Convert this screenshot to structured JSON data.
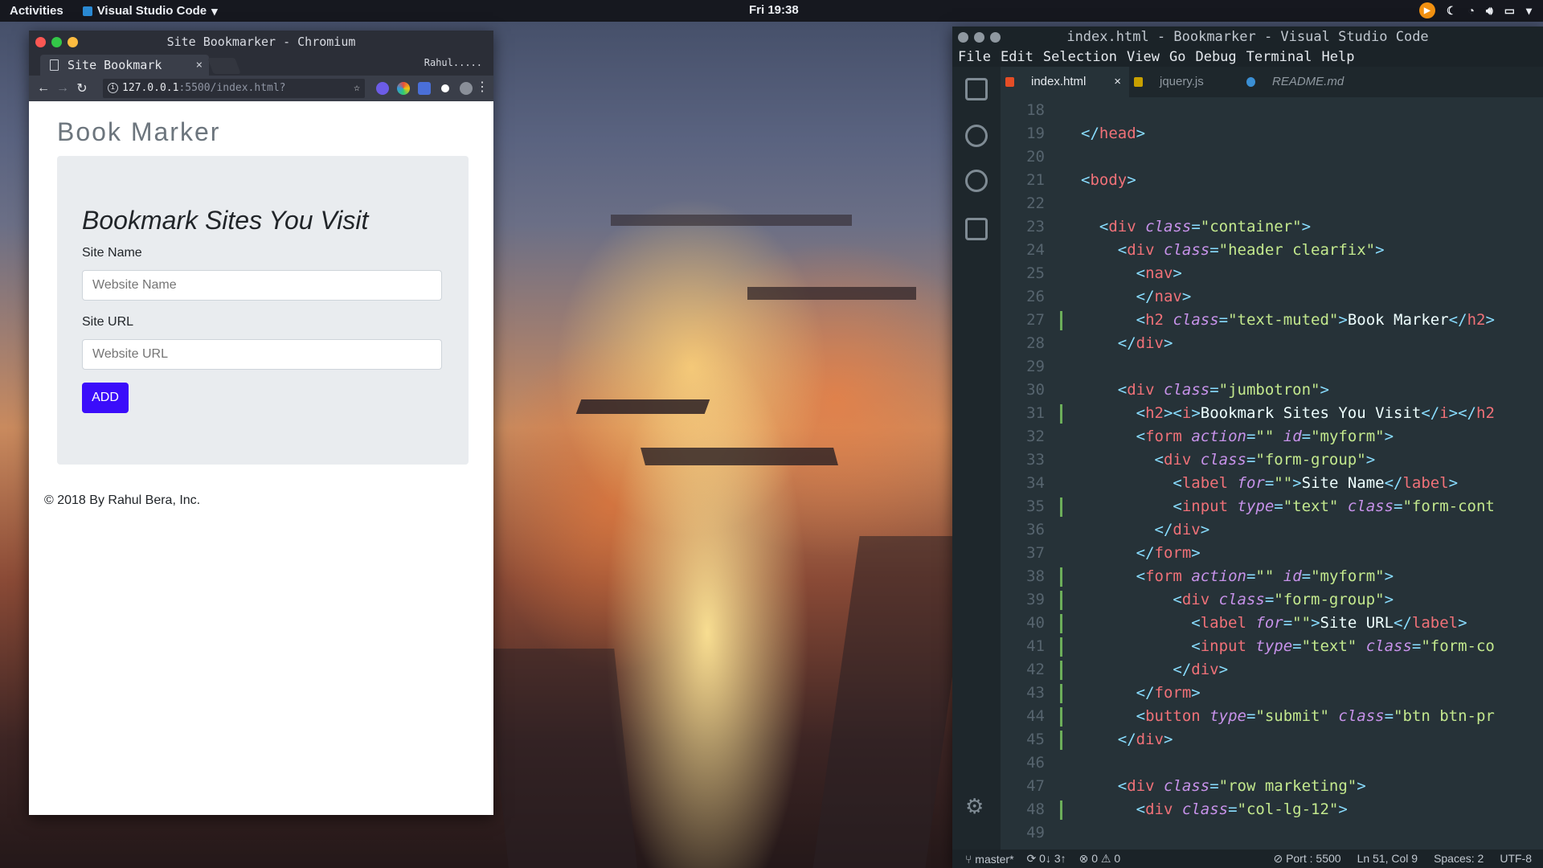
{
  "topbar": {
    "activities": "Activities",
    "app_name": "Visual Studio Code",
    "clock": "Fri 19:38"
  },
  "chromium": {
    "title": "Site Bookmarker - Chromium",
    "tab_title": "Site Bookmark",
    "profile": "Rahul.....",
    "url_host": "127.0.0.1",
    "url_path": ":5500/index.html?",
    "page": {
      "heading": "Book Marker",
      "jumbotron_title": "Bookmark Sites You Visit",
      "site_name_label": "Site Name",
      "site_name_placeholder": "Website Name",
      "site_url_label": "Site URL",
      "site_url_placeholder": "Website URL",
      "add_button": "ADD",
      "footer": "© 2018 By Rahul Bera, Inc."
    }
  },
  "vscode": {
    "title": "index.html - Bookmarker - Visual Studio Code",
    "menu": [
      "File",
      "Edit",
      "Selection",
      "View",
      "Go",
      "Debug",
      "Terminal",
      "Help"
    ],
    "tabs": [
      {
        "label": "index.html",
        "active": true
      },
      {
        "label": "jquery.js",
        "active": false
      },
      {
        "label": "README.md",
        "active": false
      }
    ],
    "lines": [
      {
        "n": "18",
        "html": ""
      },
      {
        "n": "19",
        "html": "<span class='p'>&lt;/</span><span class='t'>head</span><span class='p'>&gt;</span>"
      },
      {
        "n": "20",
        "html": ""
      },
      {
        "n": "21",
        "html": "<span class='p'>&lt;</span><span class='t'>body</span><span class='p'>&gt;</span>"
      },
      {
        "n": "22",
        "html": ""
      },
      {
        "n": "23",
        "html": "  <span class='p'>&lt;</span><span class='t'>div</span> <span class='a'>class</span><span class='p'>=</span><span class='s'>\"container\"</span><span class='p'>&gt;</span>"
      },
      {
        "n": "24",
        "html": "    <span class='p'>&lt;</span><span class='t'>div</span> <span class='a'>class</span><span class='p'>=</span><span class='s'>\"header clearfix\"</span><span class='p'>&gt;</span>"
      },
      {
        "n": "25",
        "html": "      <span class='p'>&lt;</span><span class='t'>nav</span><span class='p'>&gt;</span>"
      },
      {
        "n": "26",
        "html": "      <span class='p'>&lt;/</span><span class='t'>nav</span><span class='p'>&gt;</span>"
      },
      {
        "n": "27",
        "html": "      <span class='p'>&lt;</span><span class='t'>h2</span> <span class='a'>class</span><span class='p'>=</span><span class='s'>\"text-muted\"</span><span class='p'>&gt;</span><span class='x'>Book Marker</span><span class='p'>&lt;/</span><span class='t'>h2</span><span class='p'>&gt;</span>"
      },
      {
        "n": "28",
        "html": "    <span class='p'>&lt;/</span><span class='t'>div</span><span class='p'>&gt;</span>"
      },
      {
        "n": "29",
        "html": ""
      },
      {
        "n": "30",
        "html": "    <span class='p'>&lt;</span><span class='t'>div</span> <span class='a'>class</span><span class='p'>=</span><span class='s'>\"jumbotron\"</span><span class='p'>&gt;</span>"
      },
      {
        "n": "31",
        "html": "      <span class='p'>&lt;</span><span class='t'>h2</span><span class='p'>&gt;&lt;</span><span class='t'>i</span><span class='p'>&gt;</span><span class='x'>Bookmark Sites You Visit</span><span class='p'>&lt;/</span><span class='t'>i</span><span class='p'>&gt;&lt;/</span><span class='t'>h2</span>"
      },
      {
        "n": "32",
        "html": "      <span class='p'>&lt;</span><span class='t'>form</span> <span class='a'>action</span><span class='p'>=</span><span class='s'>\"\"</span> <span class='a'>id</span><span class='p'>=</span><span class='s'>\"myform\"</span><span class='p'>&gt;</span>"
      },
      {
        "n": "33",
        "html": "        <span class='p'>&lt;</span><span class='t'>div</span> <span class='a'>class</span><span class='p'>=</span><span class='s'>\"form-group\"</span><span class='p'>&gt;</span>"
      },
      {
        "n": "34",
        "html": "          <span class='p'>&lt;</span><span class='t'>label</span> <span class='a'>for</span><span class='p'>=</span><span class='s'>\"\"</span><span class='p'>&gt;</span><span class='x'>Site Name</span><span class='p'>&lt;/</span><span class='t'>label</span><span class='p'>&gt;</span>"
      },
      {
        "n": "35",
        "html": "          <span class='p'>&lt;</span><span class='t'>input</span> <span class='a'>type</span><span class='p'>=</span><span class='s'>\"text\"</span> <span class='a'>class</span><span class='p'>=</span><span class='s'>\"form-cont</span>"
      },
      {
        "n": "36",
        "html": "        <span class='p'>&lt;/</span><span class='t'>div</span><span class='p'>&gt;</span>"
      },
      {
        "n": "37",
        "html": "      <span class='p'>&lt;/</span><span class='t'>form</span><span class='p'>&gt;</span>"
      },
      {
        "n": "38",
        "html": "      <span class='p'>&lt;</span><span class='t'>form</span> <span class='a'>action</span><span class='p'>=</span><span class='s'>\"\"</span> <span class='a'>id</span><span class='p'>=</span><span class='s'>\"myform\"</span><span class='p'>&gt;</span>"
      },
      {
        "n": "39",
        "html": "          <span class='p'>&lt;</span><span class='t'>div</span> <span class='a'>class</span><span class='p'>=</span><span class='s'>\"form-group\"</span><span class='p'>&gt;</span>"
      },
      {
        "n": "40",
        "html": "            <span class='p'>&lt;</span><span class='t'>label</span> <span class='a'>for</span><span class='p'>=</span><span class='s'>\"\"</span><span class='p'>&gt;</span><span class='x'>Site URL</span><span class='p'>&lt;/</span><span class='t'>label</span><span class='p'>&gt;</span>"
      },
      {
        "n": "41",
        "html": "            <span class='p'>&lt;</span><span class='t'>input</span> <span class='a'>type</span><span class='p'>=</span><span class='s'>\"text\"</span> <span class='a'>class</span><span class='p'>=</span><span class='s'>\"form-co</span>"
      },
      {
        "n": "42",
        "html": "          <span class='p'>&lt;/</span><span class='t'>div</span><span class='p'>&gt;</span>"
      },
      {
        "n": "43",
        "html": "      <span class='p'>&lt;/</span><span class='t'>form</span><span class='p'>&gt;</span>"
      },
      {
        "n": "44",
        "html": "      <span class='p'>&lt;</span><span class='t'>button</span> <span class='a'>type</span><span class='p'>=</span><span class='s'>\"submit\"</span> <span class='a'>class</span><span class='p'>=</span><span class='s'>\"btn btn-pr</span>"
      },
      {
        "n": "45",
        "html": "    <span class='p'>&lt;/</span><span class='t'>div</span><span class='p'>&gt;</span>"
      },
      {
        "n": "46",
        "html": ""
      },
      {
        "n": "47",
        "html": "    <span class='p'>&lt;</span><span class='t'>div</span> <span class='a'>class</span><span class='p'>=</span><span class='s'>\"row marketing\"</span><span class='p'>&gt;</span>"
      },
      {
        "n": "48",
        "html": "      <span class='p'>&lt;</span><span class='t'>div</span> <span class='a'>class</span><span class='p'>=</span><span class='s'>\"col-lg-12\"</span><span class='p'>&gt;</span>"
      },
      {
        "n": "49",
        "html": ""
      }
    ],
    "modified_lines": [
      "27",
      "31",
      "35",
      "38",
      "39",
      "40",
      "41",
      "42",
      "43",
      "44",
      "45",
      "48"
    ],
    "status": {
      "branch": "master*",
      "sync": "0↓ 3↑",
      "errors": "0",
      "warnings": "0",
      "port": "Port : 5500",
      "position": "Ln 51, Col 9",
      "spaces": "Spaces: 2",
      "encoding": "UTF-8"
    }
  },
  "colors": {
    "add_button": "#3b0dfa",
    "vscode_bg": "#263238",
    "tag": "#f07178",
    "attribute": "#c792ea",
    "string": "#c3e88d"
  }
}
